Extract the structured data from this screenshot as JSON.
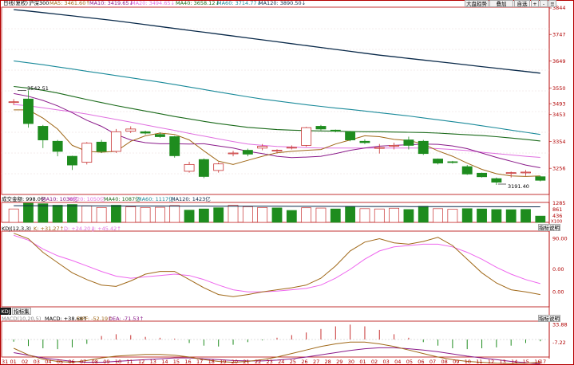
{
  "header": {
    "period": "日线(复权)",
    "name": "沪深300",
    "ma5": "MA5: 3461.60↑",
    "ma10": "MA10: 3419.65↓",
    "ma20": "MA20: 3494.65↓",
    "ma40": "MA40: 3658.12↓",
    "ma60": "MA60: 3714.77↓",
    "ma120": "MA120: 3890.50↓"
  },
  "toolbar": {
    "market_trend": "大盘趋势",
    "overlay": "叠加",
    "self_select": "自选",
    "zoom_in": "+",
    "zoom_out": "-",
    "menu": "≡"
  },
  "price_panel": {
    "axis": {
      "min": 3160,
      "max": 3844,
      "labels": [
        "3844",
        "3747",
        "3649",
        "3550",
        "3493",
        "3453",
        "3354",
        "3256"
      ]
    },
    "high_label": "3542.51",
    "low_label": "3191.40"
  },
  "volume_panel": {
    "title": "成交金额: 998.0亿",
    "ma10": "MA10: 1036亿",
    "ma20": "MA20: 1050亿",
    "ma40": "MA40: 1087亿",
    "ma60": "MA60: 1117亿",
    "ma120": "MA120: 1423亿",
    "axis_labels": [
      "1285",
      "861",
      "436",
      "X100"
    ]
  },
  "kdj_panel": {
    "title": "KDJ(12,3,3)",
    "k": "K: +31.27↑",
    "d": "D: +24.20↓",
    "j": "J: +45.42↑",
    "params_button": "指标说明",
    "axis_labels": [
      "90.00",
      "0.00",
      "0.00"
    ]
  },
  "indicator_tabs": [
    "KDJ",
    "指标集"
  ],
  "macd_panel": {
    "title": "MACD(10,20,5)",
    "macd": "MACD: +38.68↑",
    "diff": "DIFF: -52.19↑",
    "dea": "DEA: -71.53↑",
    "params_button": "指标说明",
    "axis_labels": [
      "33.88",
      "-7.22"
    ]
  },
  "x_axis_labels": [
    "31",
    "01",
    "02",
    "03",
    "04",
    "05",
    "06",
    "07",
    "08",
    "09",
    "10",
    "11",
    "12",
    "13",
    "14",
    "15",
    "16",
    "17",
    "18",
    "19",
    "20",
    "21",
    "22",
    "23",
    "24",
    "25",
    "26",
    "27",
    "28",
    "29",
    "30",
    "01",
    "02",
    "03",
    "04",
    "05",
    "06",
    "07",
    "08",
    "09",
    "10",
    "11",
    "12",
    "13",
    "14",
    "15",
    "16",
    "17"
  ],
  "colors": {
    "up": "#c83232",
    "down": "#1e8c1e",
    "ma5": "#a06818",
    "ma10": "#8a1a8a",
    "ma20": "#e070e0",
    "ma40": "#1a6a1a",
    "ma60": "#1a8a9a",
    "ma120": "#0a2a4a",
    "axis_text": "#b00000"
  },
  "chart_data": [
    {
      "type": "candlestick",
      "title": "沪深300",
      "ylim": [
        3160,
        3844
      ],
      "candles": [
        {
          "open": 3498,
          "close": 3500,
          "high": 3510,
          "low": 3488
        },
        {
          "open": 3510,
          "close": 3420,
          "high": 3542,
          "low": 3405
        },
        {
          "open": 3410,
          "close": 3360,
          "high": 3415,
          "low": 3330
        },
        {
          "open": 3355,
          "close": 3318,
          "high": 3360,
          "low": 3300
        },
        {
          "open": 3300,
          "close": 3268,
          "high": 3302,
          "low": 3250
        },
        {
          "open": 3278,
          "close": 3348,
          "high": 3352,
          "low": 3270
        },
        {
          "open": 3352,
          "close": 3318,
          "high": 3360,
          "low": 3312
        },
        {
          "open": 3318,
          "close": 3390,
          "high": 3400,
          "low": 3312
        },
        {
          "open": 3392,
          "close": 3400,
          "high": 3410,
          "low": 3385
        },
        {
          "open": 3390,
          "close": 3385,
          "high": 3394,
          "low": 3380
        },
        {
          "open": 3380,
          "close": 3372,
          "high": 3388,
          "low": 3368
        },
        {
          "open": 3372,
          "close": 3302,
          "high": 3375,
          "low": 3295
        },
        {
          "open": 3245,
          "close": 3270,
          "high": 3280,
          "low": 3240
        },
        {
          "open": 3288,
          "close": 3226,
          "high": 3292,
          "low": 3220
        },
        {
          "open": 3248,
          "close": 3272,
          "high": 3278,
          "low": 3240
        },
        {
          "open": 3310,
          "close": 3312,
          "high": 3320,
          "low": 3300
        },
        {
          "open": 3322,
          "close": 3308,
          "high": 3328,
          "low": 3300
        },
        {
          "open": 3330,
          "close": 3337,
          "high": 3345,
          "low": 3322
        },
        {
          "open": 3320,
          "close": 3322,
          "high": 3326,
          "low": 3310
        },
        {
          "open": 3330,
          "close": 3333,
          "high": 3340,
          "low": 3325
        },
        {
          "open": 3340,
          "close": 3405,
          "high": 3408,
          "low": 3335
        },
        {
          "open": 3410,
          "close": 3400,
          "high": 3415,
          "low": 3395
        },
        {
          "open": 3396,
          "close": 3392,
          "high": 3398,
          "low": 3388
        },
        {
          "open": 3390,
          "close": 3360,
          "high": 3393,
          "low": 3355
        },
        {
          "open": 3355,
          "close": 3350,
          "high": 3362,
          "low": 3345
        },
        {
          "open": 3330,
          "close": 3332,
          "high": 3345,
          "low": 3310
        },
        {
          "open": 3338,
          "close": 3340,
          "high": 3350,
          "low": 3325
        },
        {
          "open": 3360,
          "close": 3340,
          "high": 3372,
          "low": 3325
        },
        {
          "open": 3355,
          "close": 3310,
          "high": 3360,
          "low": 3305
        },
        {
          "open": 3290,
          "close": 3275,
          "high": 3292,
          "low": 3270
        },
        {
          "open": 3280,
          "close": 3278,
          "high": 3283,
          "low": 3273
        },
        {
          "open": 3262,
          "close": 3235,
          "high": 3268,
          "low": 3232
        },
        {
          "open": 3238,
          "close": 3225,
          "high": 3240,
          "low": 3222
        },
        {
          "open": 3218,
          "close": 3205,
          "high": 3222,
          "low": 3195
        },
        {
          "open": 3238,
          "close": 3240,
          "high": 3244,
          "low": 3222
        },
        {
          "open": 3240,
          "close": 3242,
          "high": 3250,
          "low": 3228
        },
        {
          "open": 3225,
          "close": 3212,
          "high": 3228,
          "low": 3208
        }
      ],
      "ma5": [
        3470,
        3470,
        3440,
        3400,
        3340,
        3318,
        3315,
        3318,
        3355,
        3375,
        3385,
        3380,
        3360,
        3320,
        3282,
        3270,
        3285,
        3300,
        3313,
        3318,
        3322,
        3325,
        3345,
        3360,
        3375,
        3372,
        3362,
        3358,
        3345,
        3320,
        3300,
        3275,
        3252,
        3236,
        3228,
        3226,
        3228
      ],
      "ma10": [
        3530,
        3520,
        3505,
        3485,
        3460,
        3432,
        3410,
        3380,
        3360,
        3350,
        3346,
        3346,
        3345,
        3346,
        3338,
        3330,
        3318,
        3310,
        3300,
        3295,
        3297,
        3300,
        3310,
        3322,
        3330,
        3337,
        3340,
        3342,
        3345,
        3344,
        3338,
        3328,
        3312,
        3296,
        3282,
        3268,
        3258
      ],
      "ma20": [
        3490,
        3485,
        3478,
        3470,
        3463,
        3455,
        3445,
        3435,
        3425,
        3415,
        3405,
        3395,
        3384,
        3374,
        3364,
        3354,
        3345,
        3340,
        3336,
        3334,
        3332,
        3330,
        3330,
        3330,
        3330,
        3330,
        3330,
        3330,
        3330,
        3328,
        3325,
        3321,
        3315,
        3310,
        3305,
        3300,
        3296
      ],
      "ma40": [
        3556,
        3550,
        3542,
        3532,
        3520,
        3508,
        3497,
        3486,
        3476,
        3466,
        3456,
        3446,
        3437,
        3428,
        3420,
        3413,
        3406,
        3402,
        3398,
        3396,
        3394,
        3393,
        3392,
        3391,
        3390,
        3390,
        3389,
        3388,
        3387,
        3385,
        3382,
        3379,
        3376,
        3372,
        3367,
        3362,
        3356
      ],
      "ma60": [
        3650,
        3643,
        3636,
        3628,
        3620,
        3612,
        3604,
        3596,
        3588,
        3580,
        3572,
        3563,
        3554,
        3545,
        3536,
        3527,
        3518,
        3510,
        3503,
        3496,
        3489,
        3483,
        3477,
        3472,
        3466,
        3460,
        3454,
        3448,
        3441,
        3434,
        3427,
        3420,
        3412,
        3404,
        3396,
        3388,
        3380
      ],
      "ma120": [
        3838,
        3833,
        3827,
        3821,
        3815,
        3809,
        3803,
        3797,
        3790,
        3783,
        3776,
        3769,
        3762,
        3755,
        3748,
        3741,
        3734,
        3727,
        3720,
        3713,
        3706,
        3699,
        3692,
        3685,
        3678,
        3671,
        3665,
        3659,
        3653,
        3647,
        3641,
        3635,
        3629,
        3623,
        3617,
        3611,
        3605
      ]
    },
    {
      "type": "bar",
      "title": "成交金额",
      "ylabel": "亿",
      "ylim": [
        0,
        1285
      ],
      "values": [
        900,
        1285,
        1250,
        1150,
        1200,
        1100,
        1000,
        1150,
        1050,
        1000,
        1010,
        1130,
        820,
        900,
        980,
        1150,
        1050,
        1000,
        970,
        800,
        980,
        960,
        900,
        1050,
        920,
        900,
        950,
        860,
        1080,
        920,
        880,
        920,
        900,
        860,
        850,
        870,
        420
      ],
      "up": [
        true,
        false,
        false,
        false,
        false,
        true,
        true,
        false,
        true,
        true,
        true,
        true,
        false,
        false,
        false,
        true,
        true,
        true,
        false,
        false,
        true,
        true,
        false,
        false,
        true,
        true,
        true,
        false,
        false,
        true,
        true,
        false,
        false,
        false,
        false,
        false,
        false
      ],
      "ma_line": [
        1120,
        1118,
        1115,
        1112,
        1110,
        1108,
        1105,
        1102,
        1100,
        1098,
        1096,
        1094,
        1092,
        1090,
        1088,
        1086,
        1084,
        1082,
        1080,
        1078,
        1076,
        1074,
        1072,
        1070,
        1068,
        1066,
        1064,
        1062,
        1060,
        1058,
        1056,
        1054,
        1052,
        1050,
        1048,
        1046,
        1044
      ]
    },
    {
      "type": "line",
      "title": "KDJ(12,3,3)",
      "ylim": [
        -10,
        100
      ],
      "series": [
        {
          "name": "K",
          "values": [
            98,
            90,
            70,
            55,
            40,
            30,
            22,
            20,
            28,
            38,
            42,
            42,
            30,
            18,
            8,
            5,
            8,
            12,
            15,
            18,
            22,
            32,
            50,
            72,
            85,
            90,
            84,
            82,
            86,
            92,
            80,
            60,
            40,
            25,
            15,
            12,
            8
          ]
        },
        {
          "name": "D",
          "values": [
            95,
            88,
            75,
            65,
            58,
            50,
            42,
            35,
            32,
            34,
            36,
            38,
            36,
            30,
            22,
            15,
            12,
            12,
            13,
            15,
            17,
            22,
            32,
            45,
            60,
            72,
            78,
            80,
            82,
            82,
            78,
            70,
            60,
            48,
            38,
            30,
            24
          ]
        }
      ]
    },
    {
      "type": "bar",
      "title": "MACD(10,20,5)",
      "ylim": [
        -40,
        40
      ],
      "values": [
        -5,
        -15,
        -20,
        -22,
        -18,
        -10,
        8,
        12,
        10,
        6,
        4,
        2,
        -8,
        -14,
        -16,
        -12,
        -6,
        -2,
        4,
        10,
        16,
        24,
        30,
        34,
        30,
        22,
        12,
        4,
        -6,
        -14,
        -20,
        -22,
        -20,
        -18,
        -14,
        -8,
        -4
      ],
      "series": [
        {
          "name": "DIFF",
          "values": [
            -20,
            -35,
            -45,
            -50,
            -52,
            -48,
            -42,
            -38,
            -36,
            -34,
            -34,
            -36,
            -40,
            -46,
            -50,
            -52,
            -50,
            -46,
            -40,
            -32,
            -24,
            -16,
            -10,
            -6,
            -6,
            -10,
            -16,
            -24,
            -32,
            -40,
            -46,
            -50,
            -52,
            -54,
            -55,
            -54,
            -52
          ]
        },
        {
          "name": "DEA",
          "values": [
            -30,
            -36,
            -42,
            -46,
            -50,
            -52,
            -52,
            -50,
            -48,
            -46,
            -44,
            -42,
            -42,
            -44,
            -46,
            -48,
            -49,
            -49,
            -47,
            -44,
            -40,
            -35,
            -30,
            -25,
            -21,
            -19,
            -19,
            -21,
            -24,
            -28,
            -33,
            -38,
            -42,
            -46,
            -50,
            -53,
            -56
          ]
        }
      ]
    }
  ]
}
